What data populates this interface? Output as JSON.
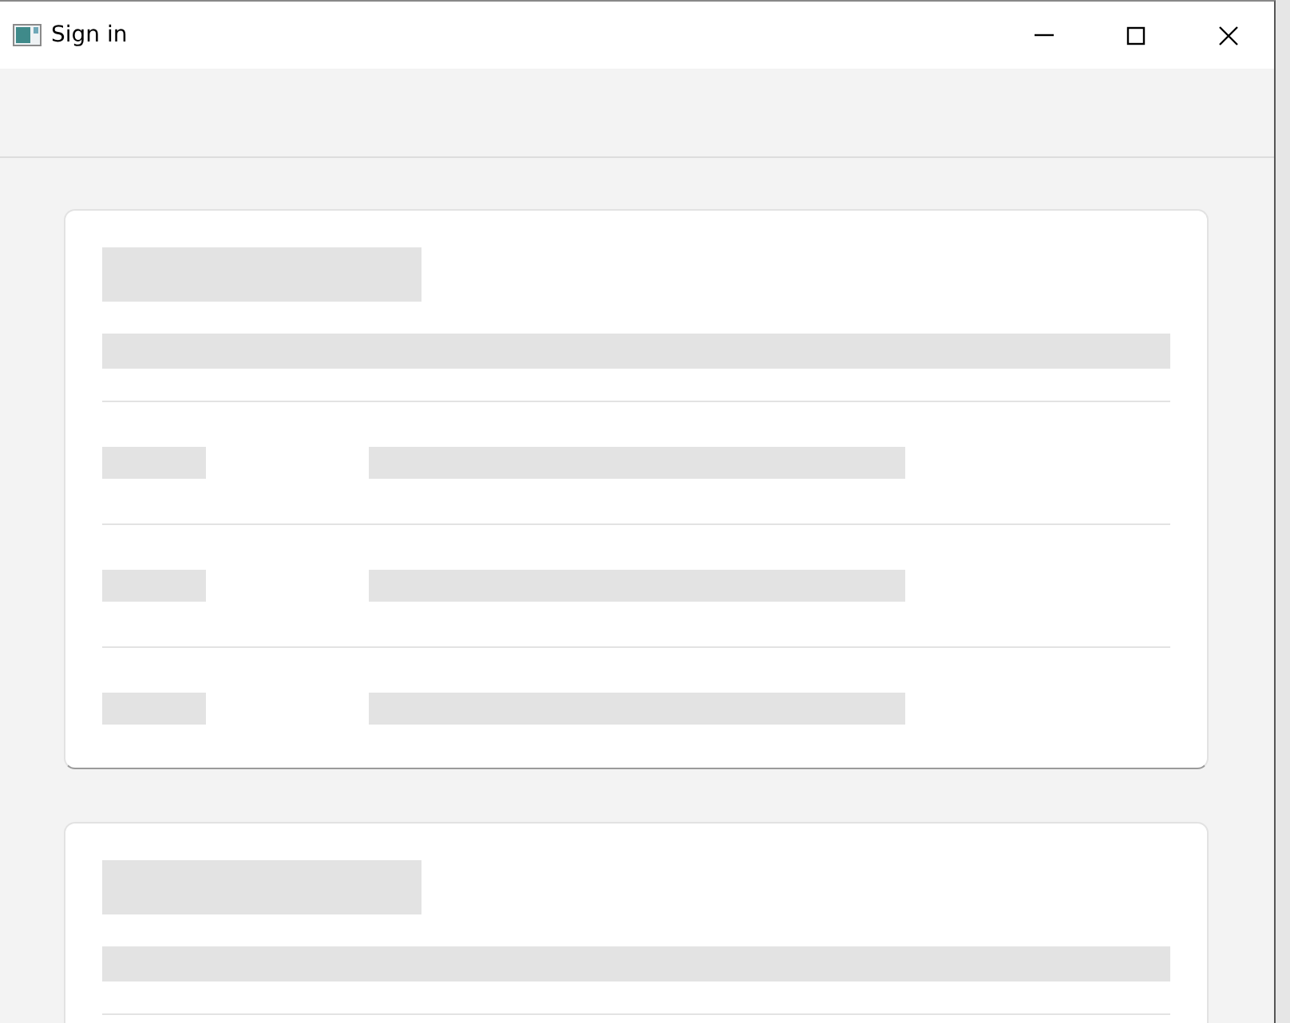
{
  "window": {
    "title": "Sign in",
    "controls": [
      {
        "kind": "minimize"
      },
      {
        "kind": "maximize"
      },
      {
        "kind": "close"
      }
    ]
  },
  "cards": [
    {
      "kind": "skeleton",
      "rows": [
        {
          "kind": "skeleton"
        },
        {
          "kind": "skeleton"
        },
        {
          "kind": "skeleton"
        }
      ]
    },
    {
      "kind": "skeleton"
    }
  ]
}
